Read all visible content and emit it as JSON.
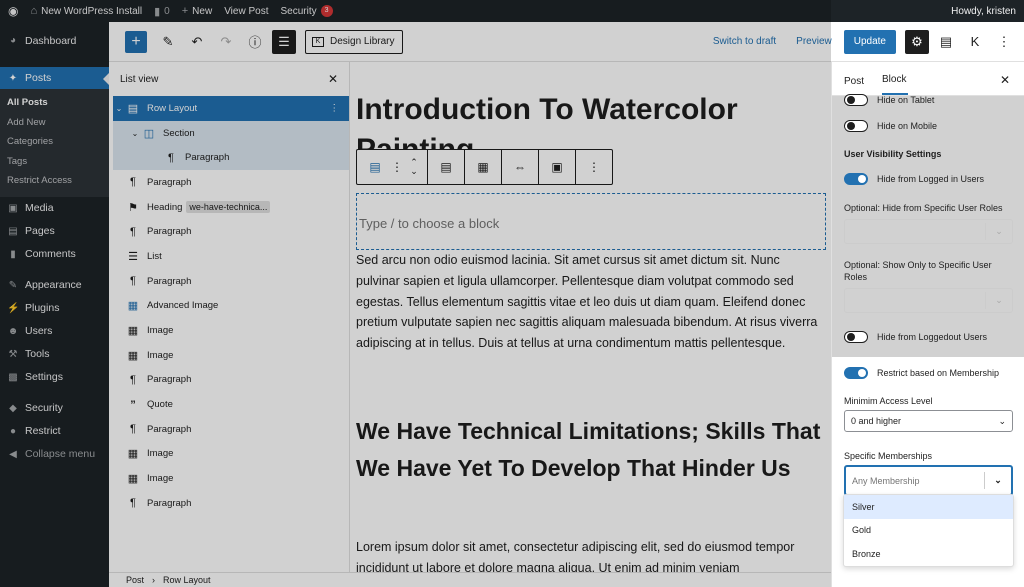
{
  "adminbar": {
    "site_name": "New WordPress Install",
    "comments_count": "0",
    "new_label": "New",
    "view_post": "View Post",
    "security_label": "Security",
    "security_badge": "3",
    "howdy": "Howdy, kristen"
  },
  "menu": {
    "dashboard": "Dashboard",
    "posts": "Posts",
    "posts_sub": [
      "All Posts",
      "Add New",
      "Categories",
      "Tags",
      "Restrict Access"
    ],
    "media": "Media",
    "pages": "Pages",
    "comments": "Comments",
    "appearance": "Appearance",
    "plugins": "Plugins",
    "users": "Users",
    "tools": "Tools",
    "settings": "Settings",
    "security": "Security",
    "restrict": "Restrict",
    "collapse": "Collapse menu"
  },
  "toolbar": {
    "design_library": "Design Library",
    "switch_to_draft": "Switch to draft",
    "preview": "Preview",
    "update": "Update"
  },
  "listview": {
    "title": "List view",
    "rows": [
      {
        "label": "Row Layout",
        "icon": "row-layout-icon"
      },
      {
        "label": "Section",
        "icon": "section-icon"
      },
      {
        "label": "Paragraph",
        "icon": "paragraph-icon"
      },
      {
        "label": "Paragraph",
        "icon": "paragraph-icon"
      },
      {
        "label": "Heading",
        "icon": "heading-icon",
        "anchor": "we-have-technica..."
      },
      {
        "label": "Paragraph",
        "icon": "paragraph-icon"
      },
      {
        "label": "List",
        "icon": "list-icon"
      },
      {
        "label": "Paragraph",
        "icon": "paragraph-icon"
      },
      {
        "label": "Advanced Image",
        "icon": "image-icon"
      },
      {
        "label": "Image",
        "icon": "image-icon"
      },
      {
        "label": "Image",
        "icon": "image-icon"
      },
      {
        "label": "Paragraph",
        "icon": "paragraph-icon"
      },
      {
        "label": "Quote",
        "icon": "quote-icon"
      },
      {
        "label": "Paragraph",
        "icon": "paragraph-icon"
      },
      {
        "label": "Image",
        "icon": "image-icon"
      },
      {
        "label": "Image",
        "icon": "image-icon"
      },
      {
        "label": "Paragraph",
        "icon": "paragraph-icon"
      }
    ]
  },
  "canvas": {
    "title": "Introduction To Watercolor Painting",
    "placeholder": "Type / to choose a block",
    "paragraph1": "Sed arcu non odio euismod lacinia. Sit amet cursus sit amet dictum sit. Nunc pulvinar sapien et ligula ullamcorper. Pellentesque diam volutpat commodo sed egestas. Tellus elementum sagittis vitae et leo duis ut diam quam. Eleifend donec pretium vulputate sapien nec sagittis aliquam malesuada bibendum. At risus viverra adipiscing at in tellus. Duis at tellus at urna condimentum mattis pellentesque.",
    "heading": "We Have Technical Limitations; Skills That We Have Yet To Develop That Hinder Us",
    "paragraph2": "Lorem ipsum dolor sit amet, consectetur adipiscing elit, sed do eiusmod tempor incididunt ut labore et dolore magna aliqua. Ut enim ad minim veniam"
  },
  "breadcrumb": [
    "Post",
    "Row Layout"
  ],
  "sidebar": {
    "tab_post": "Post",
    "tab_block": "Block",
    "hide_tablet": "Hide on Tablet",
    "hide_mobile": "Hide on Mobile",
    "user_visibility": "User Visibility Settings",
    "hide_logged_in": "Hide from Logged in Users",
    "hide_roles_label": "Optional: Hide from Specific User Roles",
    "show_roles_label": "Optional: Show Only to Specific User Roles",
    "hide_logged_out": "Hide from Loggedout Users",
    "restrict_membership": "Restrict based on Membership",
    "min_access_label": "Minimim Access Level",
    "min_access_value": "0 and higher",
    "specific_label": "Specific Memberships",
    "specific_placeholder": "Any Membership",
    "options": [
      "Silver",
      "Gold",
      "Bronze"
    ]
  }
}
